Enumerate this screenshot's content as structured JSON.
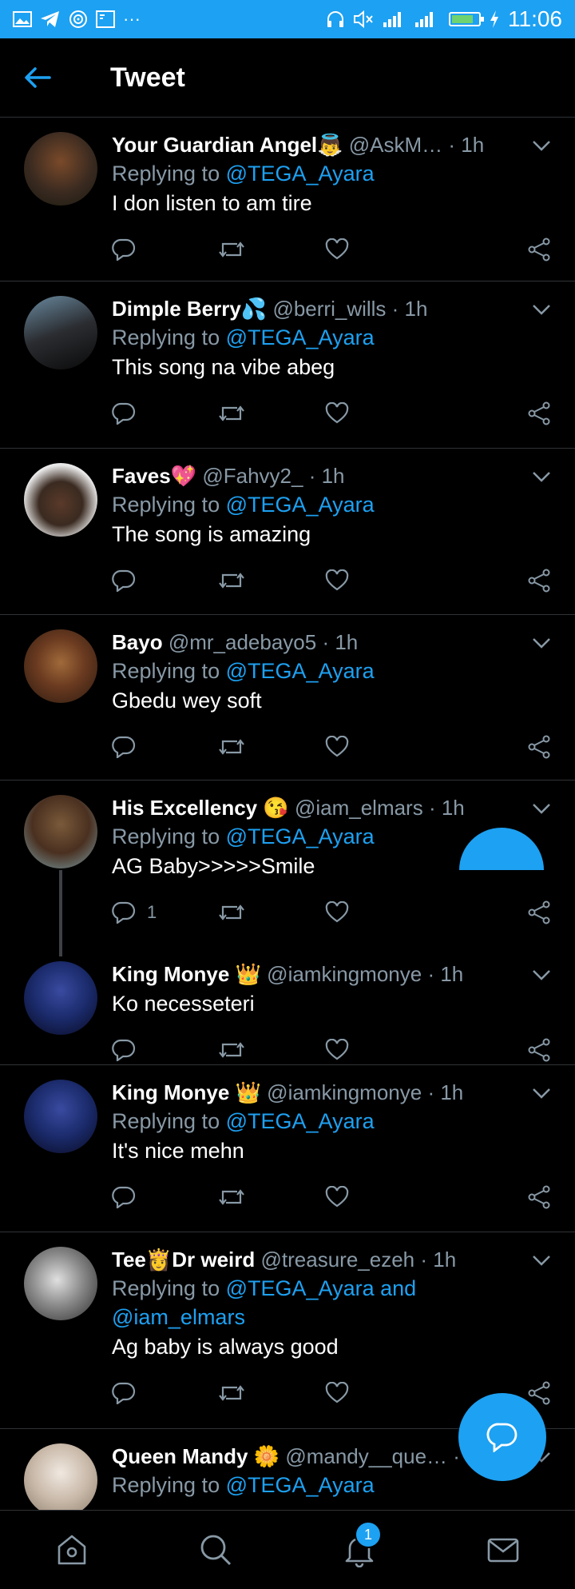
{
  "status_bar": {
    "time": "11:06",
    "left_icons": [
      "gallery-icon",
      "telegram-icon",
      "hotspot-icon",
      "image-icon"
    ],
    "more": "···"
  },
  "header": {
    "title": "Tweet"
  },
  "tweets": [
    {
      "name": "Your Guardian Angel👼",
      "handle": "@AskM…",
      "time": "· 1h",
      "reply_prefix": "Replying to",
      "reply_to": "@TEGA_Ayara",
      "text": "I don listen to am tire",
      "reply_count": "",
      "avatar_color": "#3a2a20"
    },
    {
      "name": "Dimple Berry💦",
      "handle": "@berri_wills",
      "time": "· 1h",
      "reply_prefix": "Replying to",
      "reply_to": "@TEGA_Ayara",
      "text": "This song na vibe abeg",
      "reply_count": "",
      "avatar_color": "#2a2c30"
    },
    {
      "name": "Faves💖",
      "handle": "@Fahvy2_",
      "time": "· 1h",
      "reply_prefix": "Replying to",
      "reply_to": "@TEGA_Ayara",
      "text": "The song is amazing",
      "reply_count": "",
      "avatar_color": "#d8d8d8"
    },
    {
      "name": "Bayo",
      "handle": "@mr_adebayo5",
      "time": "· 1h",
      "reply_prefix": "Replying to",
      "reply_to": "@TEGA_Ayara",
      "text": "Gbedu wey soft",
      "reply_count": "",
      "avatar_color": "#6a3a20"
    },
    {
      "name": "His Excellency 😘",
      "handle": "@iam_elmars",
      "time": "· 1h",
      "reply_prefix": "Replying to",
      "reply_to": "@TEGA_Ayara",
      "text": "AG Baby>>>>>Smile",
      "reply_count": "1",
      "avatar_color": "#4a3020"
    },
    {
      "name": "King Monye 👑",
      "handle": "@iamkingmonye",
      "time": "· 1h",
      "reply_prefix": "",
      "reply_to": "",
      "text": "Ko necesseteri",
      "reply_count": "",
      "avatar_color": "#1a2a6a"
    },
    {
      "name": "King Monye 👑",
      "handle": "@iamkingmonye",
      "time": "· 1h",
      "reply_prefix": "Replying to",
      "reply_to": "@TEGA_Ayara",
      "text": "It's nice mehn",
      "reply_count": "",
      "avatar_color": "#1a2a6a"
    },
    {
      "name": "Tee👸Dr weird",
      "handle": "@treasure_ezeh",
      "time": "· 1h",
      "reply_prefix": "Replying to",
      "reply_to": "@TEGA_Ayara and",
      "reply_to_2": "@iam_elmars",
      "text": "Ag baby is always good",
      "reply_count": "",
      "avatar_color": "#8a8a8a"
    },
    {
      "name": "Queen Mandy 🌼",
      "handle": "@mandy__que…",
      "time": "· 1h",
      "reply_prefix": "Replying to",
      "reply_to": "@TEGA_Ayara",
      "text": "",
      "reply_count": "",
      "avatar_color": "#c8b8a8"
    }
  ],
  "bottom_nav": {
    "notifications_badge": "1"
  },
  "colors": {
    "accent": "#1da1f2",
    "muted": "#8899a6",
    "divider": "#2f3336"
  }
}
